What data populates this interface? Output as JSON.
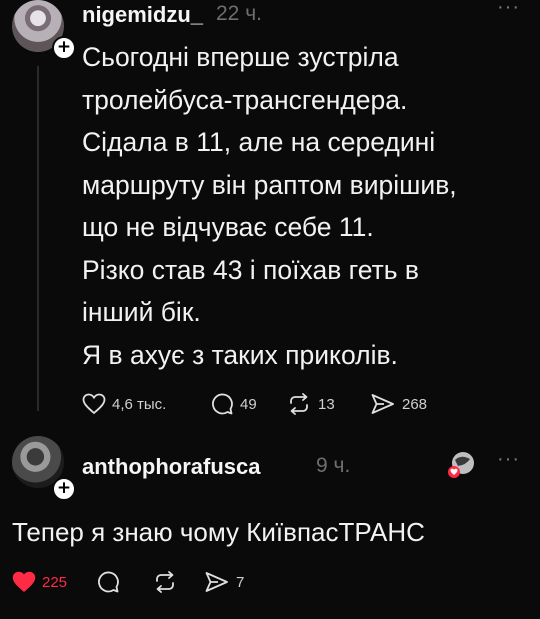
{
  "post1": {
    "username": "nigemidzu_",
    "time": "22 ч.",
    "more": "···",
    "lines": [
      "Сьогодні вперше зустріла",
      "тролейбуса-трансгендера.",
      "Сідала в 11, але на середині",
      "маршруту він раптом вирішив,",
      "що не відчуває себе 11.",
      "Різко став 43 і поїхав геть в",
      "інший бік.",
      "Я в ахує з таких приколів."
    ],
    "likes": "4,6 тыс.",
    "replies": "49",
    "reposts": "13",
    "shares": "268"
  },
  "post2": {
    "username": "anthophorafusca",
    "time": "9 ч.",
    "more": "···",
    "text": "Тепер я знаю чому КиївпасТРАНС",
    "likes": "225",
    "shares": "7"
  },
  "colors": {
    "background": "#0a0a0a",
    "text": "#f2f2f2",
    "muted": "#6e6e6e",
    "like_active": "#ff2a45"
  },
  "icons": [
    "heart-icon",
    "comment-icon",
    "repost-icon",
    "share-icon",
    "plus-icon",
    "more-icon"
  ]
}
